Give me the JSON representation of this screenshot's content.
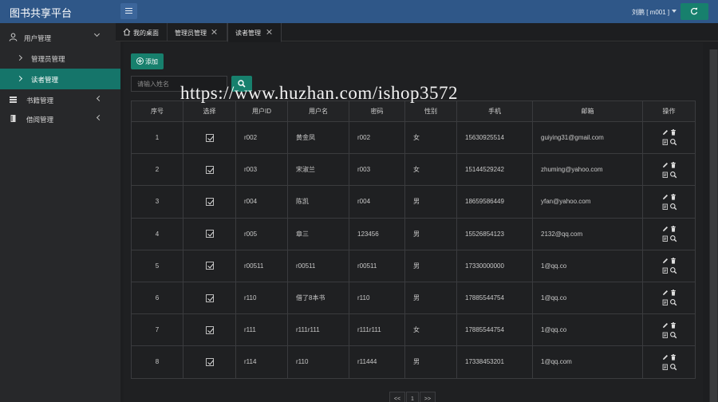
{
  "app": {
    "title": "图书共享平台"
  },
  "header": {
    "user_label": "刘鹏 [ m001 ]"
  },
  "sidebar": {
    "items": [
      {
        "label": "用户管理",
        "icon": "user-icon",
        "expanded": true
      },
      {
        "label": "管理员管理",
        "sub": true
      },
      {
        "label": "读者管理",
        "sub": true,
        "active": true
      },
      {
        "label": "书籍管理",
        "icon": "books-icon"
      },
      {
        "label": "借阅管理",
        "icon": "book-icon"
      }
    ]
  },
  "tabs": [
    {
      "label": "我的桌面",
      "icon": "home-icon"
    },
    {
      "label": "管理员管理",
      "closable": true
    },
    {
      "label": "读者管理",
      "closable": true,
      "active": true
    }
  ],
  "toolbar": {
    "add_label": "添加",
    "search_placeholder": "请输入姓名"
  },
  "table": {
    "headers": [
      "序号",
      "选择",
      "用户ID",
      "用户名",
      "密码",
      "性别",
      "手机",
      "邮箱",
      "操作"
    ],
    "rows": [
      {
        "no": "1",
        "checked": true,
        "id": "r002",
        "name": "黄金凤",
        "password": "r002",
        "gender": "女",
        "phone": "15630925514",
        "email": "guiying31@gmail.com"
      },
      {
        "no": "2",
        "checked": true,
        "id": "r003",
        "name": "宋淑兰",
        "password": "r003",
        "gender": "女",
        "phone": "15144529242",
        "email": "zhuming@yahoo.com"
      },
      {
        "no": "3",
        "checked": true,
        "id": "r004",
        "name": "陈凯",
        "password": "r004",
        "gender": "男",
        "phone": "18659586449",
        "email": "yfan@yahoo.com"
      },
      {
        "no": "4",
        "checked": true,
        "id": "r005",
        "name": "章三",
        "password": "123456",
        "gender": "男",
        "phone": "15526854123",
        "email": "2132@qq.com"
      },
      {
        "no": "5",
        "checked": true,
        "id": "r00511",
        "name": "r00511",
        "password": "r00511",
        "gender": "男",
        "phone": "17330000000",
        "email": "1@qq.co"
      },
      {
        "no": "6",
        "checked": true,
        "id": "r110",
        "name": "借了8本书",
        "password": "r110",
        "gender": "男",
        "phone": "17885544754",
        "email": "1@qq.co"
      },
      {
        "no": "7",
        "checked": true,
        "id": "r111",
        "name": "r111r111",
        "password": "r111r111",
        "gender": "女",
        "phone": "17885544754",
        "email": "1@qq.co"
      },
      {
        "no": "8",
        "checked": true,
        "id": "r114",
        "name": "r110",
        "password": "r11444",
        "gender": "男",
        "phone": "17338453201",
        "email": "1@qq.com"
      }
    ]
  },
  "pagination": {
    "prev": "<<",
    "current": "1",
    "next": ">>"
  },
  "watermark": "https://www.huzhan.com/ishop3572",
  "colors": {
    "header_bg": "#2f5788",
    "accent": "#17806d",
    "sidebar_bg": "#27282a",
    "content_bg": "#1f2022"
  }
}
